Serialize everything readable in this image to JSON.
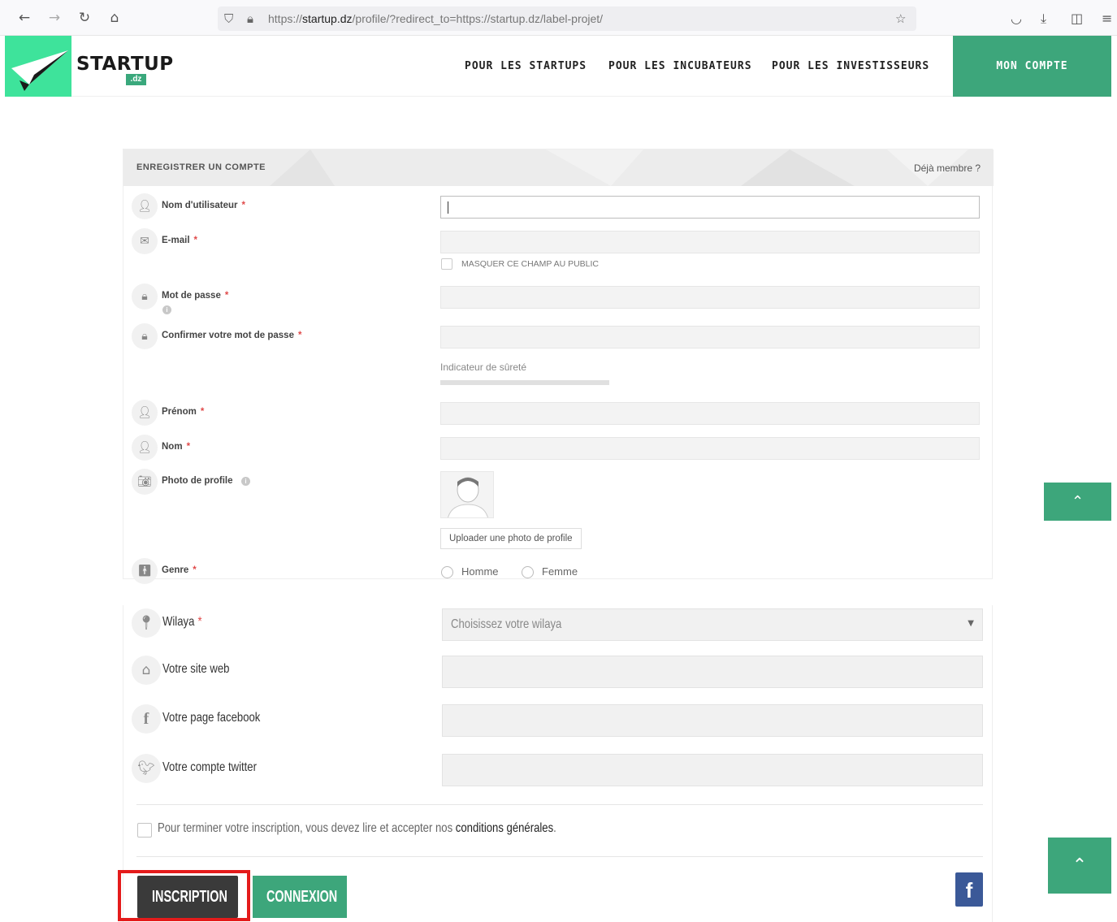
{
  "browser": {
    "url_prefix": "https://",
    "url_domain": "startup.dz",
    "url_path": "/profile/?redirect_to=https://startup.dz/label-projet/"
  },
  "header": {
    "logo_text": "STARTUP",
    "logo_badge": ".dz",
    "nav": [
      "POUR LES STARTUPS",
      "POUR LES INCUBATEURS",
      "POUR LES INVESTISSEURS"
    ],
    "account_button": "MON COMPTE"
  },
  "form": {
    "title": "ENREGISTRER UN COMPTE",
    "member_link": "Déjà membre ?",
    "username_label": "Nom d'utilisateur",
    "email_label": "E-mail",
    "hide_public_label": "MASQUER CE CHAMP AU PUBLIC",
    "password_label": "Mot de passe",
    "confirm_label": "Confirmer votre mot de passe",
    "strength_label": "Indicateur de sûreté",
    "firstname_label": "Prénom",
    "lastname_label": "Nom",
    "photo_label": "Photo de profile",
    "upload_button": "Uploader une photo de profile",
    "gender_label": "Genre",
    "gender_options": [
      "Homme",
      "Femme"
    ],
    "required_mark": "*"
  },
  "lower": {
    "wilaya_label": "Wilaya",
    "wilaya_placeholder": "Choisissez votre wilaya",
    "website_label": "Votre site web",
    "facebook_label": "Votre page facebook",
    "twitter_label": "Votre compte twitter",
    "terms_text": "Pour terminer votre inscription, vous devez lire et accepter nos",
    "terms_link": "conditions générales",
    "terms_end": ".",
    "register_button": "INSCRIPTION",
    "login_button": "CONNEXION",
    "facebook_button": "f"
  },
  "colors": {
    "brand_green": "#3da67b",
    "logo_green": "#3ee39b",
    "highlight_red": "#e41b1b",
    "facebook_blue": "#3b5998"
  }
}
